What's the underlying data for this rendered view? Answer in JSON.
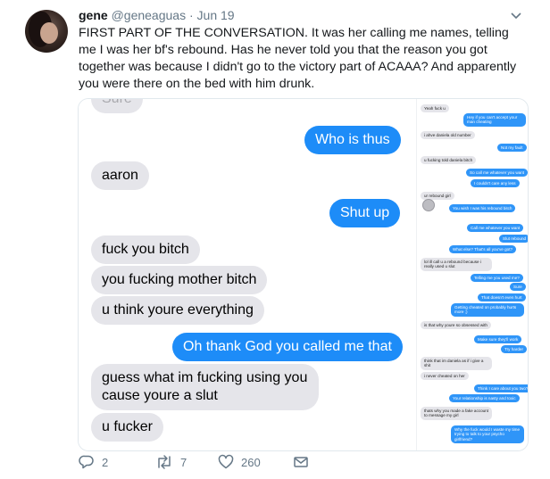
{
  "tweet": {
    "author_name": "gene",
    "handle": "@geneaguas",
    "separator": "·",
    "date": "Jun 19",
    "text": "FIRST PART OF THE CONVERSATION. It was her calling me names, telling me I was her bf's rebound. Has he never told you that the reason you got together was because I didn't go to the victory part of ACAAA? And apparently you were there on the bed with him drunk."
  },
  "main_conversation": {
    "top_cut_text": "Sure",
    "bubbles": [
      {
        "side": "out",
        "text": "Who is thus"
      },
      {
        "side": "in",
        "text": "aaron"
      },
      {
        "side": "out",
        "text": "Shut up"
      },
      {
        "side": "in",
        "text": "fuck you bitch"
      },
      {
        "side": "in",
        "text": "you fucking mother bitch"
      },
      {
        "side": "in",
        "text": "u think youre everything"
      },
      {
        "side": "out",
        "text": "Oh thank God you called me that"
      },
      {
        "side": "in",
        "text": "guess what im fucking using you cause youre a slut"
      },
      {
        "side": "in",
        "text": "u fucker"
      }
    ]
  },
  "side_conversation": {
    "bubbles": [
      {
        "side": "in",
        "text": "Yeah fuck u"
      },
      {
        "side": "out",
        "text": "Hey if you can't accept your man cheating"
      },
      {
        "side": "in",
        "text": "i ahve daniela old number"
      },
      {
        "side": "out",
        "text": "Not my fault"
      },
      {
        "side": "in",
        "text": "u fucking told daniela bitch"
      },
      {
        "side": "out",
        "text": "So call me whatever you want"
      },
      {
        "side": "out",
        "text": "I couldn't care any less"
      },
      {
        "side": "in",
        "text": "ur rebound girl"
      },
      {
        "side": "out",
        "text": "You wish I was his rebound bitch"
      },
      {
        "side": "out",
        "text": "Call me whatever you want"
      },
      {
        "side": "out",
        "text": "Slut rebound"
      },
      {
        "side": "out",
        "text": "What else? That's all you've got?"
      },
      {
        "side": "in",
        "text": "lol ill call u a rebound because i really used u slut"
      },
      {
        "side": "out",
        "text": "Telling me you used me?"
      },
      {
        "side": "out",
        "text": "Sure"
      },
      {
        "side": "out",
        "text": "That doesn't even hurt"
      },
      {
        "side": "out",
        "text": "Getting cheated on probably hurts more ;)"
      },
      {
        "side": "in",
        "text": "is that why youre so obsessed with"
      },
      {
        "side": "out",
        "text": "Make sure they'll work"
      },
      {
        "side": "out",
        "text": "Try harder"
      },
      {
        "side": "in",
        "text": "think that im daniela as if i give a shit"
      },
      {
        "side": "in",
        "text": "i never cheated on her"
      },
      {
        "side": "out",
        "text": "Think I care about you two?"
      },
      {
        "side": "out",
        "text": "Your relationship is nasty and toxic"
      },
      {
        "side": "in",
        "text": "thats why you made a fake account to message my girl"
      },
      {
        "side": "out",
        "text": "Why the fuck would I waste my time trying to talk to your psycho girlfriend?"
      }
    ]
  },
  "actions": {
    "reply_count": "2",
    "retweet_count": "7",
    "like_count": "260"
  },
  "icons": {
    "reply": "reply-icon",
    "retweet": "retweet-icon",
    "like": "heart-icon",
    "message": "envelope-icon",
    "caret": "chevron-down-icon"
  },
  "colors": {
    "outgoing_bubble": "#1d8cf8",
    "incoming_bubble": "#e5e5ea",
    "secondary_text": "#657786"
  }
}
